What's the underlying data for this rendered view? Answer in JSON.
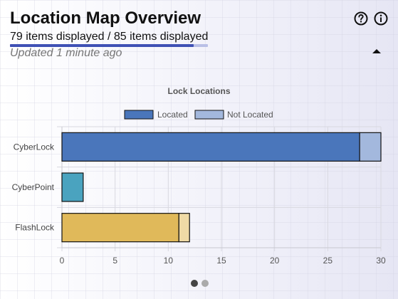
{
  "header": {
    "title": "Location Map Overview",
    "count_text": "79 items displayed / 85 items displayed",
    "progress": 0.929,
    "updated_text": "Updated 1 minute ago"
  },
  "icons": {
    "help": "help-circle-icon",
    "info": "info-circle-icon",
    "collapse": "caret-up-icon"
  },
  "pagination": {
    "pages": 2,
    "active": 0
  },
  "colors": {
    "progress_fill": "#3f51b5",
    "progress_track": "#b9bfe6"
  },
  "chart_data": {
    "type": "bar",
    "orientation": "horizontal",
    "stacked": true,
    "title": "Lock Locations",
    "categories": [
      "CyberLock",
      "CyberPoint",
      "FlashLock"
    ],
    "series": [
      {
        "name": "Located",
        "values": [
          28,
          2,
          11
        ]
      },
      {
        "name": "Not Located",
        "values": [
          2,
          0,
          1
        ]
      }
    ],
    "bar_colors": [
      [
        "#4a76bb",
        "#a3b8dd"
      ],
      [
        "#4aa3bf",
        "#a7d4e2"
      ],
      [
        "#e0b95a",
        "#efdaa6"
      ]
    ],
    "legend_colors": [
      "#4a76bb",
      "#a3b8dd"
    ],
    "xlim": [
      0,
      30
    ],
    "xticks": [
      "0",
      "5",
      "10",
      "15",
      "20",
      "25",
      "30"
    ],
    "grid": true,
    "legend_position": "top"
  }
}
